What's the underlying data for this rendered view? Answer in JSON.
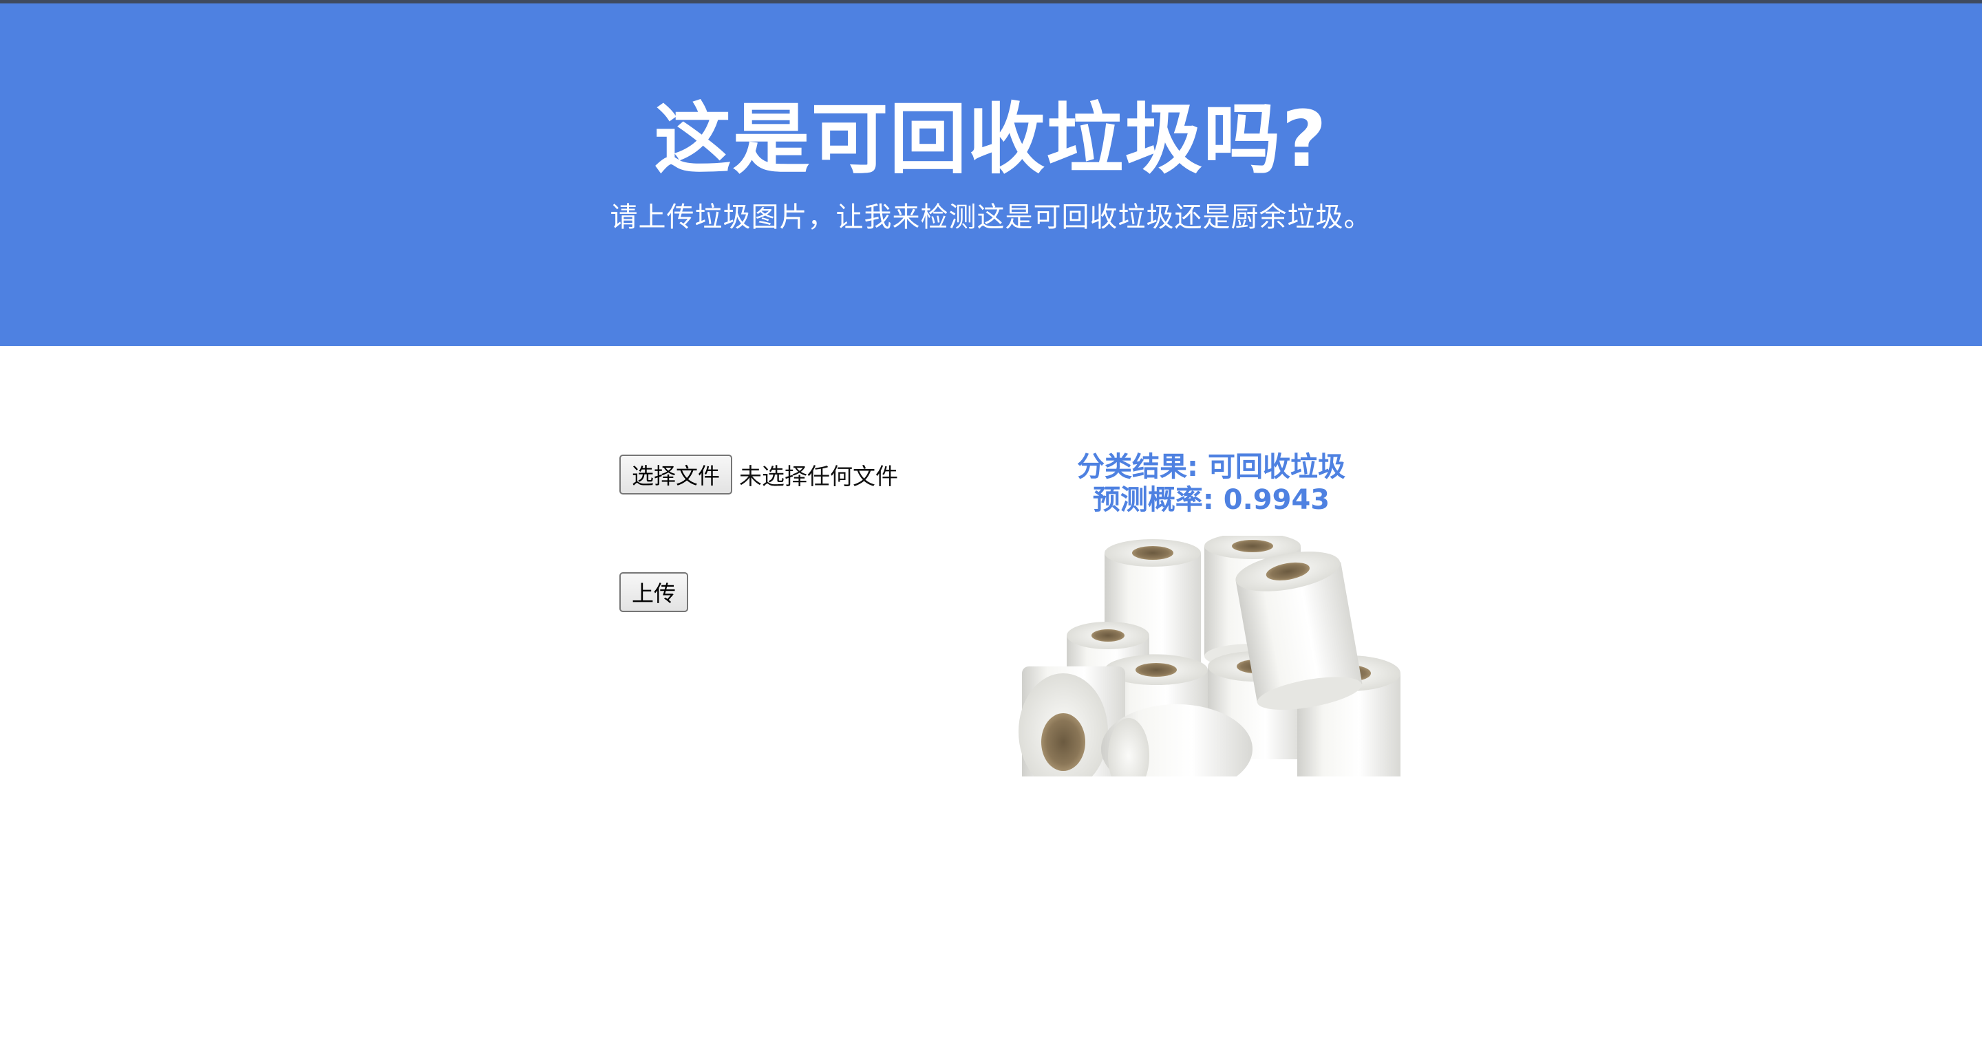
{
  "header": {
    "title": "这是可回收垃圾吗?",
    "subtitle": "请上传垃圾图片，让我来检测这是可回收垃圾还是厨余垃圾。"
  },
  "upload": {
    "choose_file_label": "选择文件",
    "file_status": "未选择任何文件",
    "submit_label": "上传"
  },
  "result": {
    "classification_label": "分类结果",
    "classification_value": "可回收垃圾",
    "classification_text": "分类结果: 可回收垃圾",
    "probability_label": "预测概率",
    "probability_value": 0.9943,
    "probability_text": "预测概率: 0.9943",
    "image_subject": "toilet-paper-rolls"
  },
  "colors": {
    "header_background": "#4e81e1",
    "accent_text": "#4e81e1",
    "header_text": "#ffffff"
  }
}
